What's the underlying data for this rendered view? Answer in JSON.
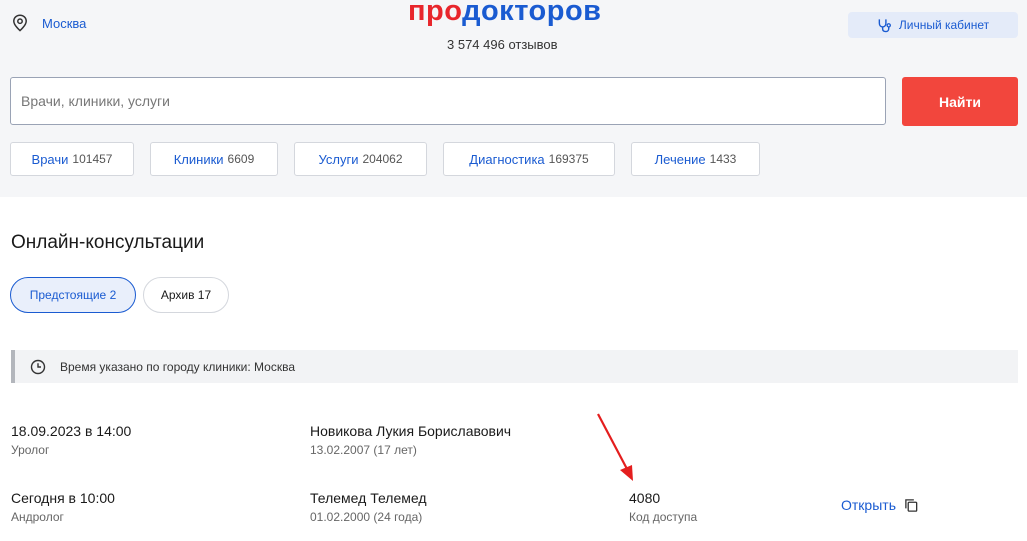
{
  "header": {
    "city": "Москва",
    "logo_part1": "про",
    "logo_part2": "докторов",
    "reviews": "3 574 496 отзывов",
    "cabinet_label": "Личный кабинет",
    "search_placeholder": "Врачи, клиники, услуги",
    "search_button": "Найти"
  },
  "categories": [
    {
      "label": "Врачи",
      "count": "101457"
    },
    {
      "label": "Клиники",
      "count": "6609"
    },
    {
      "label": "Услуги",
      "count": "204062"
    },
    {
      "label": "Диагностика",
      "count": "169375"
    },
    {
      "label": "Лечение",
      "count": "1433"
    }
  ],
  "page": {
    "title": "Онлайн-консультации",
    "tabs": {
      "upcoming": "Предстоящие 2",
      "archive": "Архив 17"
    },
    "notice": "Время указано по городу клиники: Москва"
  },
  "consultations": [
    {
      "datetime": "18.09.2023 в 14:00",
      "specialty": "Уролог",
      "patient": "Новикова Лукия Бориславович",
      "dob": "13.02.2007 (17 лет)"
    },
    {
      "datetime": "Сегодня в 10:00",
      "specialty": "Андролог",
      "patient": "Телемед Телемед",
      "dob": "01.02.2000 (24 года)",
      "code": "4080",
      "code_label": "Код доступа",
      "open_label": "Открыть"
    }
  ],
  "colors": {
    "brand_red": "#e8262c",
    "brand_blue": "#1a5bd1",
    "button_red": "#f2463d",
    "annotation_arrow": "#e41e1e"
  }
}
